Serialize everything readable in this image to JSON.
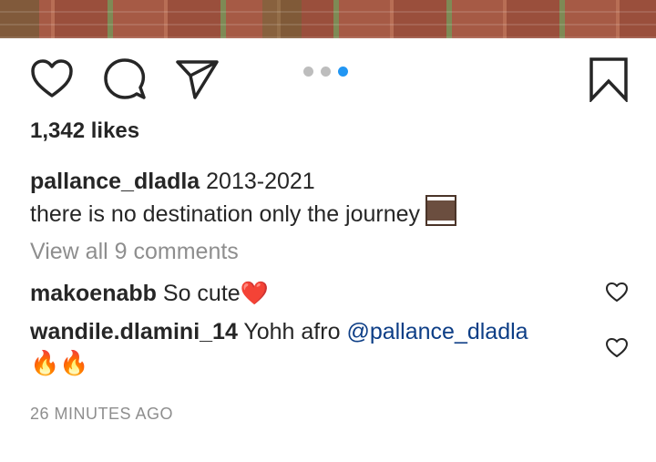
{
  "post": {
    "like_count": "1,342 likes",
    "caption_user": "pallance_dladla",
    "caption_line1": "2013-2021",
    "caption_line2": "there is no destination only the journey",
    "caption_emoji": "film-frames-emoji",
    "view_all_comments": "View all 9 comments",
    "timestamp": "26 MINUTES AGO",
    "carousel": {
      "total": 3,
      "active_index": 2,
      "active_color": "#2196f3",
      "inactive_color": "#bdbdbd"
    }
  },
  "actions": {
    "like_icon": "heart-icon",
    "comment_icon": "comment-bubble-icon",
    "share_icon": "paper-plane-icon",
    "save_icon": "bookmark-icon"
  },
  "comments": [
    {
      "user": "makoenabb",
      "text": "So cute",
      "emoji": "❤️"
    },
    {
      "user": "wandile.dlamini_14",
      "text": "Yohh afro",
      "mention": "@pallance_dladla",
      "emoji_line": "🔥🔥"
    }
  ],
  "colors": {
    "text": "#262626",
    "muted": "#8e8e8e",
    "mention": "#0d3e86",
    "accent": "#2196f3"
  }
}
